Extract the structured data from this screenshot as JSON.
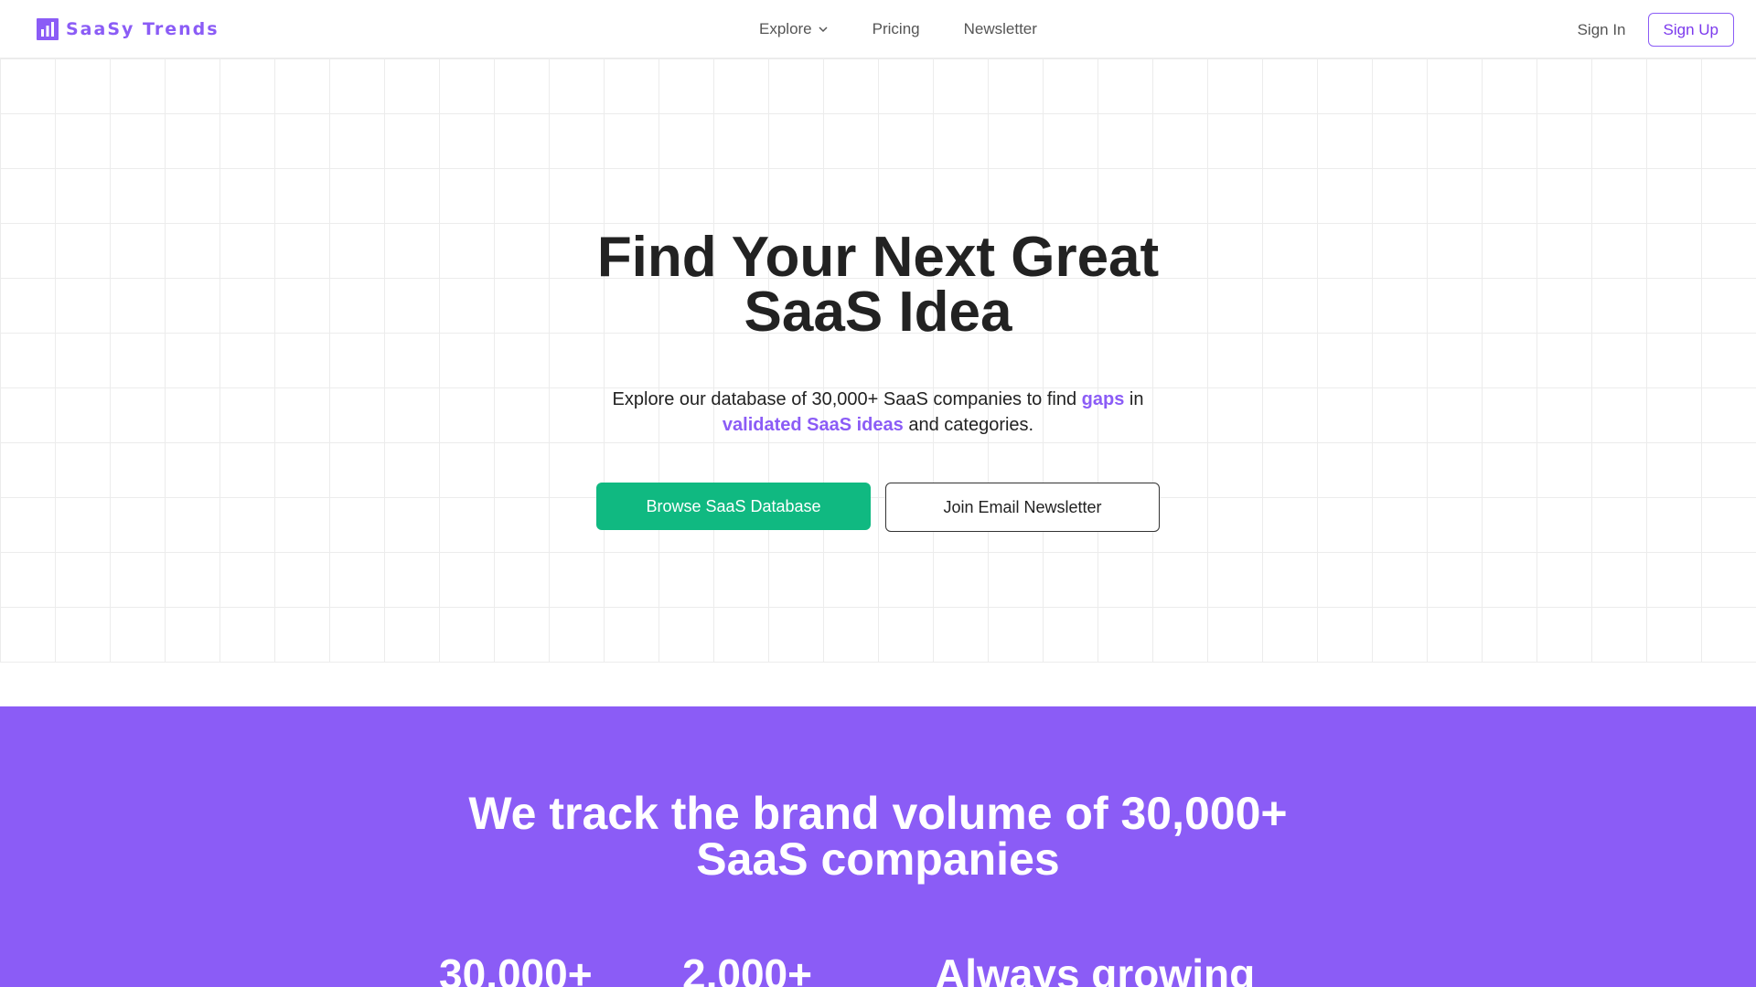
{
  "nav": {
    "brand": "SaaSy Trends",
    "explore": "Explore",
    "pricing": "Pricing",
    "newsletter": "Newsletter",
    "sign_in": "Sign In",
    "sign_up": "Sign Up"
  },
  "hero": {
    "title_line1": "Find Your Next Great",
    "title_line2": "SaaS Idea",
    "subtitle_part1": "Explore our database of 30,000+ SaaS companies to find ",
    "subtitle_highlight1": "gaps",
    "subtitle_part2": " in ",
    "subtitle_highlight2": "validated SaaS ideas",
    "subtitle_part3": " and categories.",
    "primary_button": "Browse SaaS Database",
    "secondary_button": "Join Email Newsletter"
  },
  "stats": {
    "title_line1": "We track the brand volume of 30,000+",
    "title_line2": "SaaS companies",
    "items": [
      {
        "value": "30,000+"
      },
      {
        "value": "2,000+"
      },
      {
        "value": "Always growing"
      }
    ]
  },
  "colors": {
    "brand_purple": "#8b5cf6",
    "primary_green": "#10b981",
    "text_dark": "#222222",
    "grid_line": "#ececec"
  },
  "icons": {
    "brand": "bar-chart-icon",
    "explore_dropdown": "chevron-down-icon"
  }
}
